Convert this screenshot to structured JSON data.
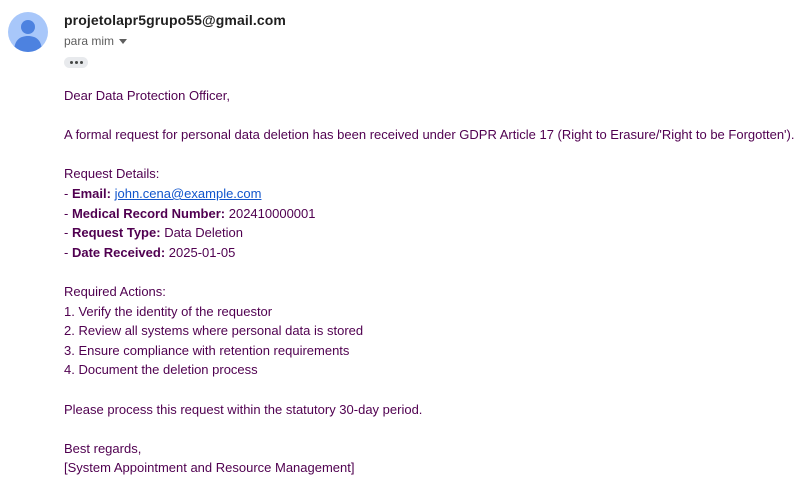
{
  "sender": {
    "email": "projetolapr5grupo55@gmail.com",
    "recipient_label": "para mim",
    "avatar_color": "#a8c7fa"
  },
  "toolbar": {
    "ellipsis_icon": "more-horiz-icon"
  },
  "body": {
    "greeting": "Dear Data Protection Officer,",
    "intro": "A formal request for personal data deletion has been received under GDPR Article 17 (Right to Erasure/'Right to be Forgotten').",
    "details_heading": "Request Details:",
    "details": [
      {
        "prefix": "- ",
        "label": "Email:",
        "value": "john.cena@example.com",
        "is_link": true
      },
      {
        "prefix": "- ",
        "label": "Medical Record Number:",
        "value": "202410000001",
        "is_link": false
      },
      {
        "prefix": "- ",
        "label": "Request Type:",
        "value": "Data Deletion",
        "is_link": false
      },
      {
        "prefix": "- ",
        "label": "Date Received:",
        "value": "2025-01-05",
        "is_link": false
      }
    ],
    "actions_heading": "Required Actions:",
    "actions": [
      "1. Verify the identity of the requestor",
      "2. Review all systems where personal data is stored",
      "3. Ensure compliance with retention requirements",
      "4. Document the deletion process"
    ],
    "closing_note": "Please process this request within the statutory 30-day period.",
    "signoff": "Best regards,",
    "signature": "[System Appointment and Resource Management]"
  },
  "colors": {
    "body_text": "#500050",
    "link": "#1155cc",
    "sender_text": "#1f1f1f"
  }
}
